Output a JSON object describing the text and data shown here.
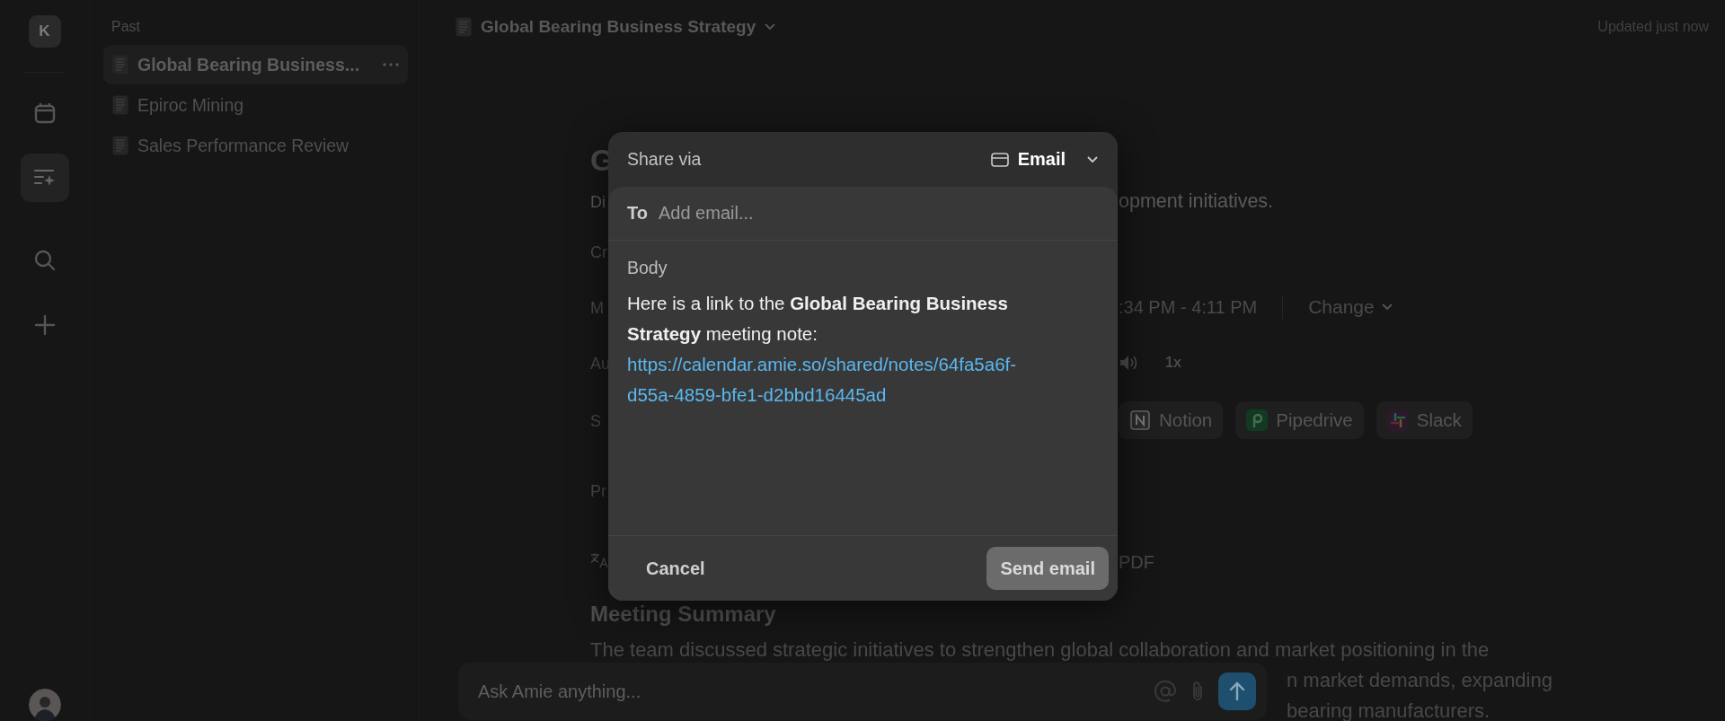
{
  "rail": {
    "workspace_initial": "K",
    "items": [
      {
        "kind": "calendar",
        "selected": false
      },
      {
        "kind": "notes",
        "selected": true
      },
      {
        "kind": "search",
        "selected": false
      },
      {
        "kind": "add",
        "selected": false
      }
    ]
  },
  "sidebar": {
    "section": "Past",
    "items": [
      {
        "title": "Global Bearing Business...",
        "selected": true
      },
      {
        "title": "Epiroc Mining",
        "selected": false
      },
      {
        "title": "Sales Performance Review",
        "selected": false
      }
    ]
  },
  "header": {
    "title": "Global Bearing Business Strategy",
    "status": "Updated just now"
  },
  "document": {
    "title": "G",
    "rows": [
      {
        "kind": "description",
        "left": "Di",
        "right": "opment initiatives."
      },
      {
        "kind": "field",
        "left": "Cr"
      },
      {
        "kind": "meeting",
        "left": "M",
        "right": ":34 PM - 4:11 PM",
        "action": "Change"
      },
      {
        "kind": "audio",
        "left": "Au",
        "right": "1x"
      },
      {
        "kind": "share",
        "left": "S",
        "integrations": [
          {
            "kind": "notion",
            "name": "Notion"
          },
          {
            "kind": "pipedrive",
            "name": "Pipedrive"
          },
          {
            "kind": "slack",
            "name": "Slack"
          }
        ]
      },
      {
        "kind": "properties",
        "left": "Pr"
      },
      {
        "kind": "export",
        "right": "PDF"
      }
    ],
    "summary_heading": "Meeting Summary",
    "summary_lines": [
      {
        "left": "The team discussed strategic initiatives to strengthen global collaboration and market positioning in the"
      },
      {
        "right": "n market demands, expanding"
      },
      {
        "right": "bearing manufacturers."
      }
    ]
  },
  "share_dialog": {
    "title": "Share via",
    "method": "Email",
    "to_label": "To",
    "to_placeholder": "Add email...",
    "body_label": "Body",
    "body_text": "Here is a link to the **Global Bearing Business Strategy** meeting note:",
    "link": "https://calendar.amie.so/shared/notes/64fa5a6f-d55a-4859-bfe1-d2bbd16445ad",
    "cancel": "Cancel",
    "send": {
      "label": "Send email",
      "disabled": true
    }
  },
  "chat": {
    "placeholder": "Ask Amie anything..."
  }
}
